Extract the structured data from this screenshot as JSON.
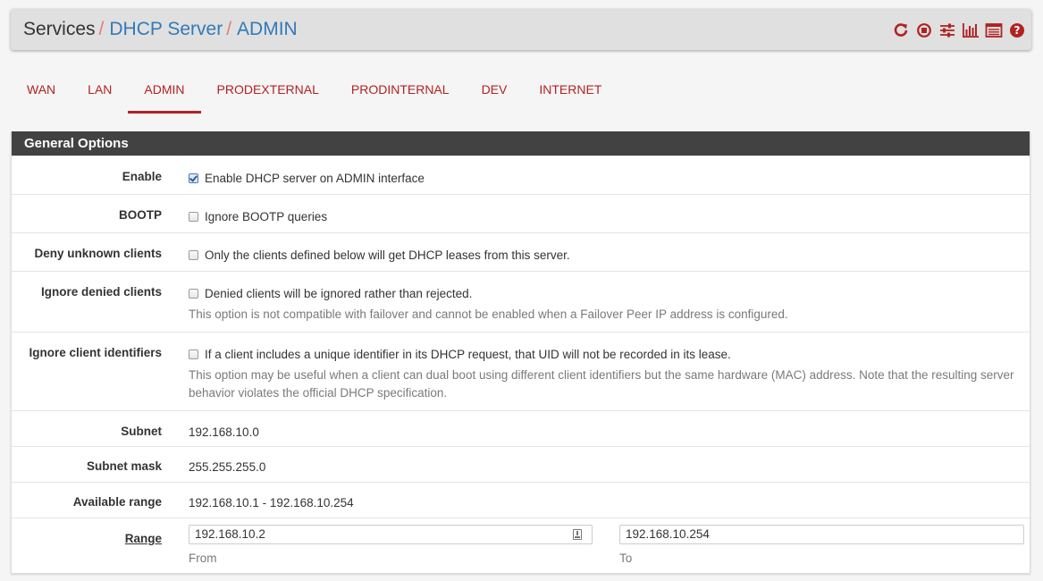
{
  "breadcrumb": {
    "section": "Services",
    "separator": "/",
    "page": "DHCP Server",
    "current": "ADMIN"
  },
  "header_icons": [
    "restart-icon",
    "stop-icon",
    "settings-sliders-icon",
    "bar-chart-icon",
    "log-list-icon",
    "help-icon"
  ],
  "accent_color": "#b22222",
  "link_color": "#337ab7",
  "tabs": [
    {
      "label": "WAN",
      "active": false
    },
    {
      "label": "LAN",
      "active": false
    },
    {
      "label": "ADMIN",
      "active": true
    },
    {
      "label": "PRODEXTERNAL",
      "active": false
    },
    {
      "label": "PRODINTERNAL",
      "active": false
    },
    {
      "label": "DEV",
      "active": false
    },
    {
      "label": "INTERNET",
      "active": false
    }
  ],
  "panel": {
    "title": "General Options",
    "enable": {
      "label": "Enable",
      "text": "Enable DHCP server on ADMIN interface",
      "checked": true
    },
    "bootp": {
      "label": "BOOTP",
      "text": "Ignore BOOTP queries",
      "checked": false
    },
    "deny_unknown": {
      "label": "Deny unknown clients",
      "text": "Only the clients defined below will get DHCP leases from this server.",
      "checked": false
    },
    "ignore_denied": {
      "label": "Ignore denied clients",
      "text": "Denied clients will be ignored rather than rejected.",
      "help": "This option is not compatible with failover and cannot be enabled when a Failover Peer IP address is configured.",
      "checked": false
    },
    "ignore_client_ids": {
      "label": "Ignore client identifiers",
      "text": "If a client includes a unique identifier in its DHCP request, that UID will not be recorded in its lease.",
      "help": "This option may be useful when a client can dual boot using different client identifiers but the same hardware (MAC) address. Note that the resulting server behavior violates the official DHCP specification.",
      "checked": false
    },
    "subnet": {
      "label": "Subnet",
      "value": "192.168.10.0"
    },
    "subnet_mask": {
      "label": "Subnet mask",
      "value": "255.255.255.0"
    },
    "available_range": {
      "label": "Available range",
      "value": "192.168.10.1 - 192.168.10.254"
    },
    "range": {
      "label": "Range",
      "from_value": "192.168.10.2",
      "from_caption": "From",
      "to_value": "192.168.10.254",
      "to_caption": "To"
    }
  }
}
